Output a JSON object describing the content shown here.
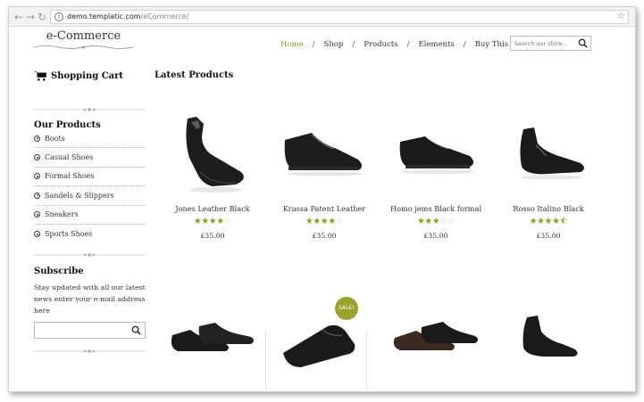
{
  "browser": {
    "url_host": "demo.templatic.com",
    "url_path": "/eCommerce/",
    "back_icon": "back-arrow-icon",
    "forward_icon": "forward-arrow-icon",
    "reload_icon": "reload-icon",
    "bookmark_icon": "star-icon"
  },
  "site": {
    "logo": "e-Commerce",
    "nav": [
      {
        "label": "Home",
        "active": true
      },
      {
        "label": "Shop"
      },
      {
        "label": "Products"
      },
      {
        "label": "Elements"
      },
      {
        "label": "Buy This Theme"
      }
    ],
    "nav_separator": "/",
    "search_placeholder": "Search our store...",
    "accent_color": "#8f9a2e"
  },
  "sidebar": {
    "cart_label": "Shopping Cart",
    "products_title": "Our Products",
    "categories": [
      "Boots",
      "Casual Shoes",
      "Formal Shoes",
      "Sandels & Slippers",
      "Sneakers",
      "Sports Shoes"
    ],
    "subscribe_title": "Subscribe",
    "subscribe_text": "Stay updated with all our latest news enter your e-mail address here"
  },
  "main": {
    "section_title": "Latest Products",
    "products": [
      {
        "name": "Jones Leather Black",
        "rating": 4,
        "price": "£35.00"
      },
      {
        "name": "Krassa Patent Leather",
        "rating": 4,
        "price": "£35.00"
      },
      {
        "name": "Homo jems Black formal",
        "rating": 3,
        "price": "£35.00"
      },
      {
        "name": "Rosso Italino Black",
        "rating": 4.5,
        "price": "£35.00"
      }
    ],
    "sale_badge": "SALE!"
  }
}
